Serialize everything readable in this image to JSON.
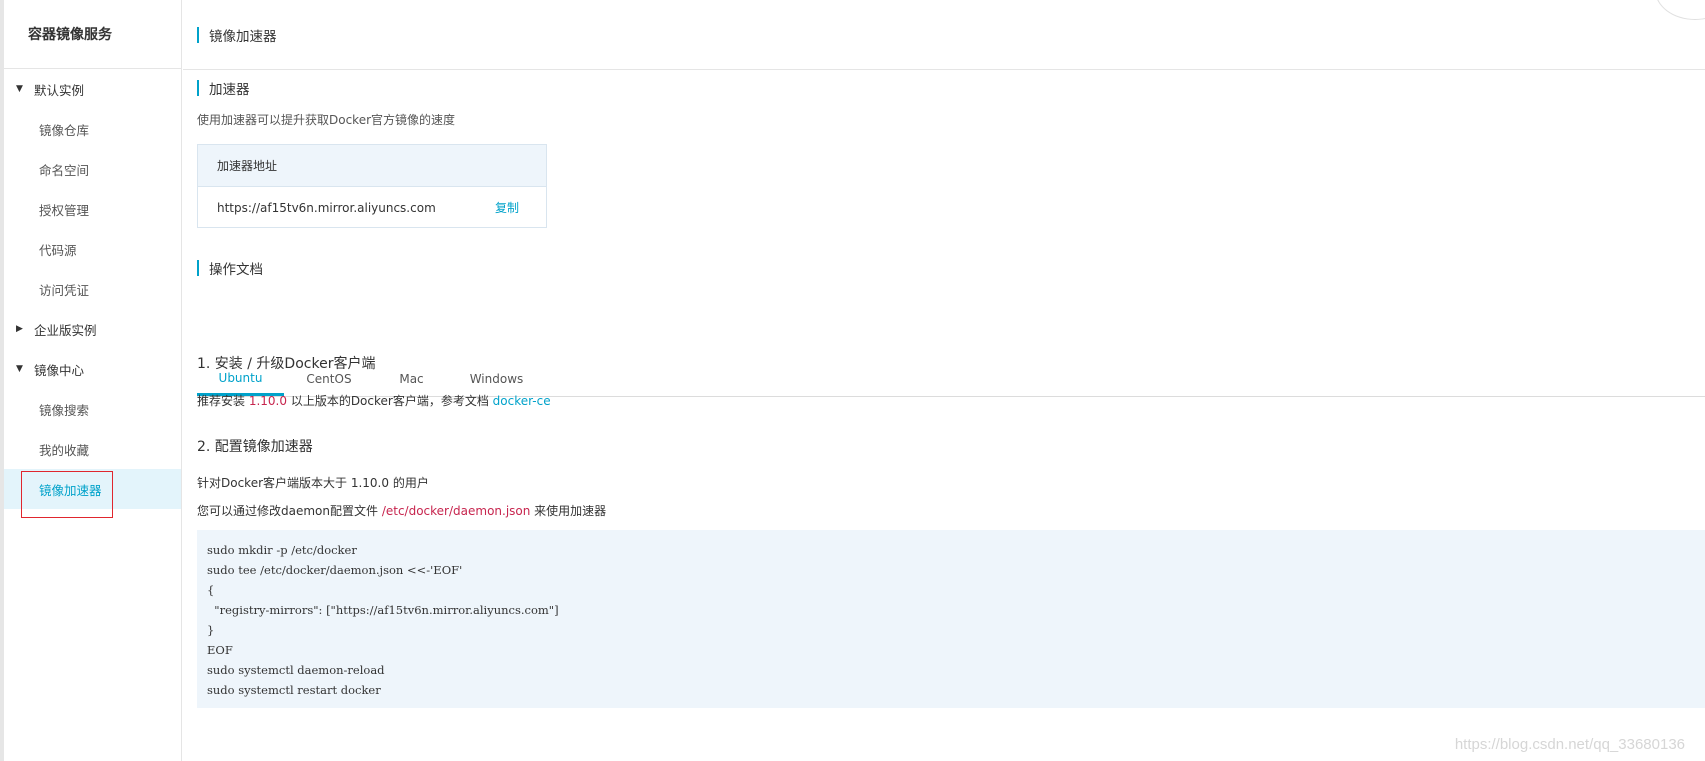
{
  "sidebar": {
    "title": "容器镜像服务",
    "groups": [
      {
        "label": "默认实例",
        "expanded": true,
        "items": [
          "镜像仓库",
          "命名空间",
          "授权管理",
          "代码源",
          "访问凭证"
        ]
      },
      {
        "label": "企业版实例",
        "expanded": false,
        "items": []
      },
      {
        "label": "镜像中心",
        "expanded": true,
        "items": [
          "镜像搜索",
          "我的收藏",
          "镜像加速器"
        ]
      }
    ],
    "active_item": "镜像加速器"
  },
  "header": {
    "title": "镜像加速器"
  },
  "accelerator": {
    "section_title": "加速器",
    "description": "使用加速器可以提升获取Docker官方镜像的速度",
    "table_header": "加速器地址",
    "address": "https://af15tv6n.mirror.aliyuncs.com",
    "copy_label": "复制"
  },
  "docs": {
    "section_title": "操作文档",
    "tabs": [
      "Ubuntu",
      "CentOS",
      "Mac",
      "Windows"
    ],
    "active_tab": "Ubuntu",
    "step1": {
      "title": "1. 安装 / 升级Docker客户端",
      "text_before": "推荐安装 ",
      "version": "1.10.0",
      "text_middle": " 以上版本的Docker客户端，参考文档 ",
      "link": "docker-ce"
    },
    "step2": {
      "title": "2. 配置镜像加速器",
      "line1": "针对Docker客户端版本大于 1.10.0 的用户",
      "line2_before": "您可以通过修改daemon配置文件 ",
      "line2_path": "/etc/docker/daemon.json",
      "line2_after": " 来使用加速器"
    },
    "code_lines": [
      "sudo mkdir -p /etc/docker",
      "sudo tee /etc/docker/daemon.json <<-'EOF'",
      "{",
      "  \"registry-mirrors\": [\"https://af15tv6n.mirror.aliyuncs.com\"]",
      "}",
      "EOF",
      "sudo systemctl daemon-reload",
      "sudo systemctl restart docker"
    ]
  },
  "watermark": "https://blog.csdn.net/qq_33680136",
  "colors": {
    "accent": "#00a2ca",
    "highlight_border": "#e0262e",
    "code_bg": "#eef5fb",
    "red_text": "#c7254e"
  }
}
